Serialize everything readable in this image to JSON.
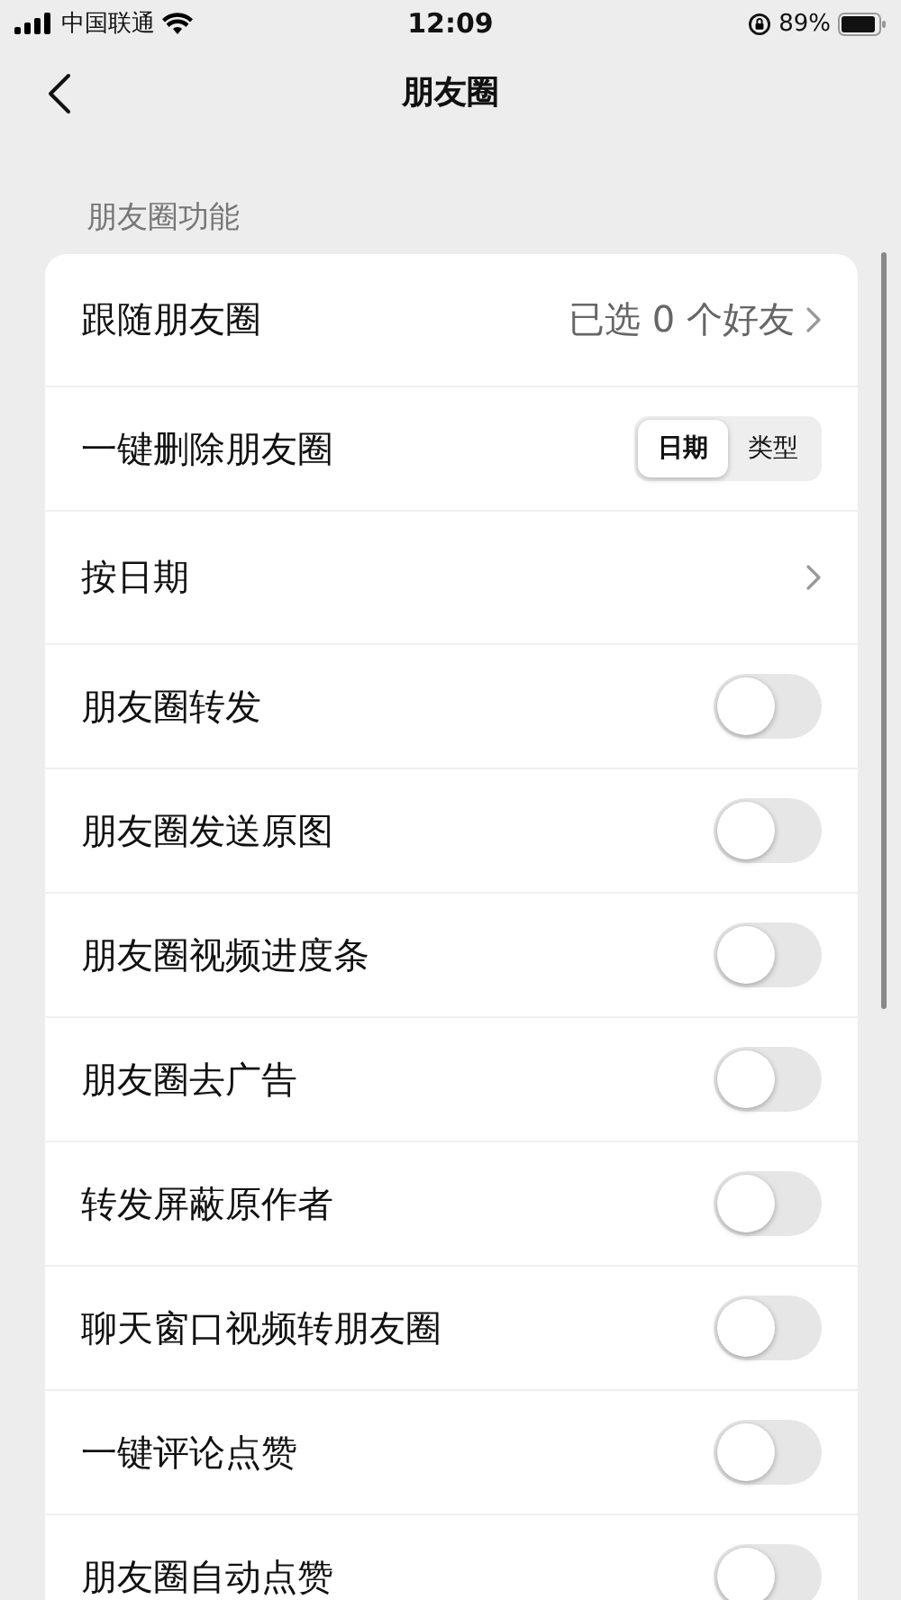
{
  "status_bar": {
    "carrier": "中国联通",
    "time": "12:09",
    "battery": "89%"
  },
  "nav": {
    "title": "朋友圈"
  },
  "section": {
    "title": "朋友圈功能",
    "rows": [
      {
        "kind": "value",
        "label": "跟随朋友圈",
        "value": "已选 0 个好友"
      },
      {
        "kind": "segment",
        "label": "一键删除朋友圈",
        "options": [
          {
            "label": "日期",
            "selected": true
          },
          {
            "label": "类型",
            "selected": false
          }
        ]
      },
      {
        "kind": "link",
        "label": "按日期"
      },
      {
        "kind": "toggle",
        "label": "朋友圈转发",
        "on": false
      },
      {
        "kind": "toggle",
        "label": "朋友圈发送原图",
        "on": false
      },
      {
        "kind": "toggle",
        "label": "朋友圈视频进度条",
        "on": false
      },
      {
        "kind": "toggle",
        "label": "朋友圈去广告",
        "on": false
      },
      {
        "kind": "toggle",
        "label": "转发屏蔽原作者",
        "on": false
      },
      {
        "kind": "toggle",
        "label": "聊天窗口视频转朋友圈",
        "on": false
      },
      {
        "kind": "toggle",
        "label": "一键评论点赞",
        "on": false
      },
      {
        "kind": "toggle",
        "label": "朋友圈自动点赞",
        "on": false
      }
    ]
  }
}
